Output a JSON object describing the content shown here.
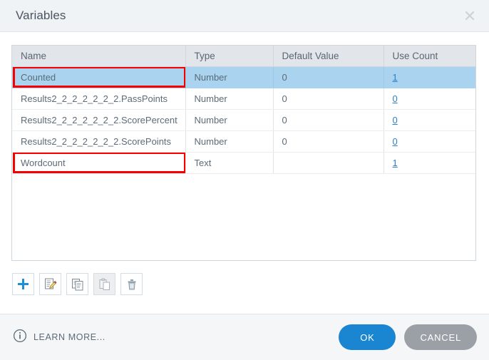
{
  "dialog": {
    "title": "Variables",
    "close_icon": "close-icon"
  },
  "table": {
    "columns": [
      "Name",
      "Type",
      "Default Value",
      "Use Count"
    ],
    "rows": [
      {
        "name": "Counted",
        "type": "Number",
        "default_value": "0",
        "use_count": "1",
        "selected": true,
        "annotated": true
      },
      {
        "name": "Results2_2_2_2_2_2_2.PassPoints",
        "type": "Number",
        "default_value": "0",
        "use_count": "0",
        "selected": false,
        "annotated": false
      },
      {
        "name": "Results2_2_2_2_2_2_2.ScorePercent",
        "type": "Number",
        "default_value": "0",
        "use_count": "0",
        "selected": false,
        "annotated": false
      },
      {
        "name": "Results2_2_2_2_2_2_2.ScorePoints",
        "type": "Number",
        "default_value": "0",
        "use_count": "0",
        "selected": false,
        "annotated": false
      },
      {
        "name": "Wordcount",
        "type": "Text",
        "default_value": "",
        "use_count": "1",
        "selected": false,
        "annotated": true
      }
    ]
  },
  "toolbar": {
    "buttons": [
      {
        "name": "add-variable-button",
        "icon": "plus-icon",
        "disabled": false
      },
      {
        "name": "edit-variable-button",
        "icon": "edit-pencil-icon",
        "disabled": false
      },
      {
        "name": "copy-variable-button",
        "icon": "copy-icon",
        "disabled": false
      },
      {
        "name": "paste-variable-button",
        "icon": "paste-icon",
        "disabled": true
      },
      {
        "name": "delete-variable-button",
        "icon": "trash-icon",
        "disabled": false
      }
    ]
  },
  "footer": {
    "learn_more_label": "LEARN MORE...",
    "info_icon": "info-icon",
    "ok_label": "OK",
    "cancel_label": "CANCEL"
  },
  "colors": {
    "accent_blue": "#1a85d0",
    "selected_row": "#a9d3ee",
    "annotation_red": "#f90000",
    "cancel_grey": "#9aa0a6",
    "link_blue": "#2a7fc9",
    "titlebar_bg": "#eff3f6",
    "header_bg": "#e2e6ea"
  }
}
